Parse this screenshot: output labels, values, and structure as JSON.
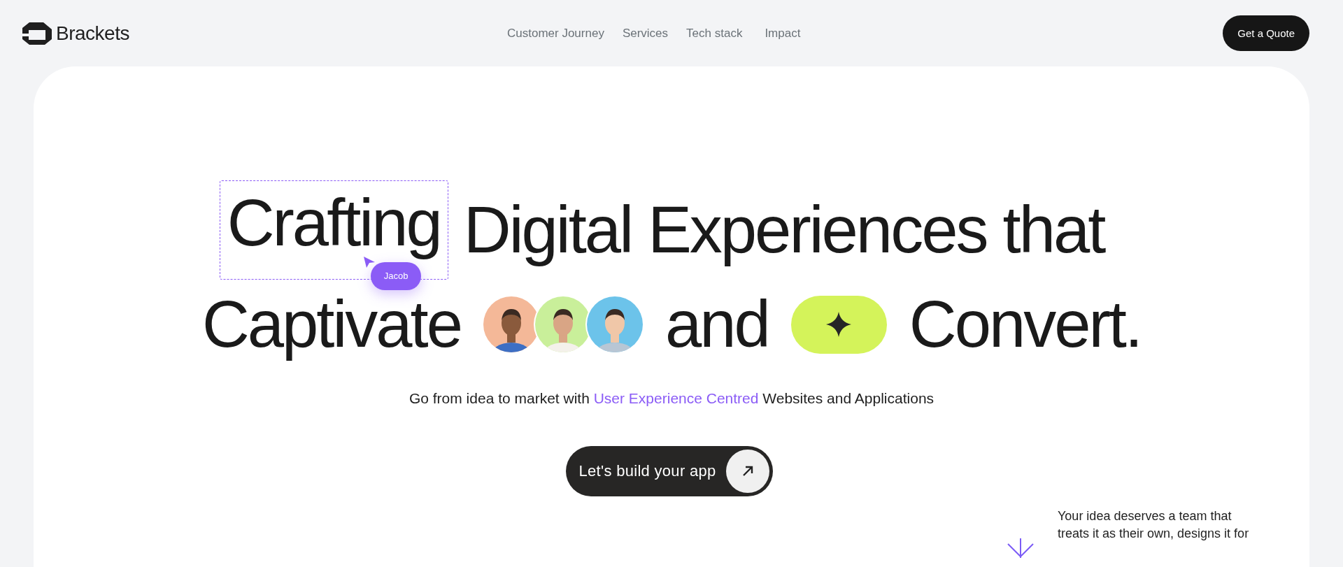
{
  "header": {
    "logo_text": "Brackets",
    "nav": [
      {
        "label": "Customer Journey"
      },
      {
        "label": "Services"
      },
      {
        "label": "Tech stack"
      },
      {
        "label": "Impact"
      }
    ],
    "quote_button": "Get a Quote"
  },
  "hero": {
    "line_1": {
      "framed_word": "Crafting",
      "rest": "Digital Experiences that"
    },
    "cursor": {
      "label": "Jacob"
    },
    "line_2": {
      "first": "Captivate",
      "middle": "and",
      "last": "Convert."
    },
    "avatars": [
      {
        "kind": "picture"
      },
      {
        "kind": "picture"
      },
      {
        "kind": "picture"
      }
    ],
    "subtitle": {
      "before": "Go from idea to market with",
      "highlight": "User Experience Centred",
      "after": "Websites and Applications"
    },
    "cta_button": "Let's build your app",
    "aside_lines": [
      "Your idea deserves a team that",
      "treats it as their own, designs it for"
    ]
  }
}
